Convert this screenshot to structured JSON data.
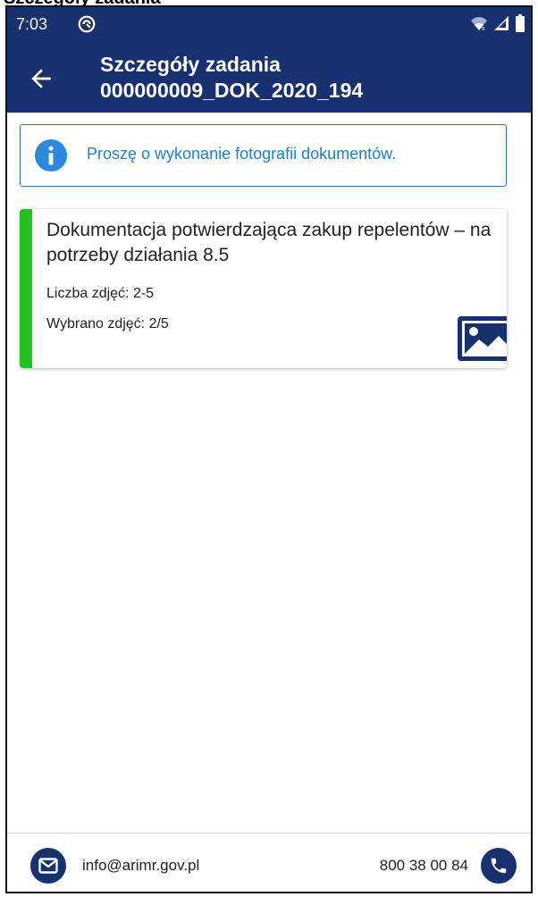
{
  "caption": "Szczegóły zadania",
  "status_bar": {
    "time": "7:03",
    "icons": [
      "app-notification-icon",
      "wifi-icon",
      "signal-icon",
      "battery-icon"
    ]
  },
  "header": {
    "back_icon": "arrow-back-icon",
    "title_line1": "Szczegóły zadania",
    "title_line2": "000000009_DOK_2020_194"
  },
  "info": {
    "icon": "info-icon",
    "text": "Proszę o wykonanie fotografii dokumentów."
  },
  "task": {
    "title": "Dokumentacja potwierdzająca zakup repelentów – na potrzeby działania 8.5",
    "count": "Liczba zdjęć: 2-5",
    "selected": "Wybrano zdjęć: 2/5",
    "status_color": "#22c11c",
    "photo_icon": "image-icon"
  },
  "footer": {
    "email": "info@arimr.gov.pl",
    "phone": "800 38 00 84",
    "email_icon": "mail-icon",
    "phone_icon": "phone-icon"
  },
  "colors": {
    "primary": "#17306f",
    "info_blue": "#1f7ed4",
    "success": "#22c11c"
  }
}
